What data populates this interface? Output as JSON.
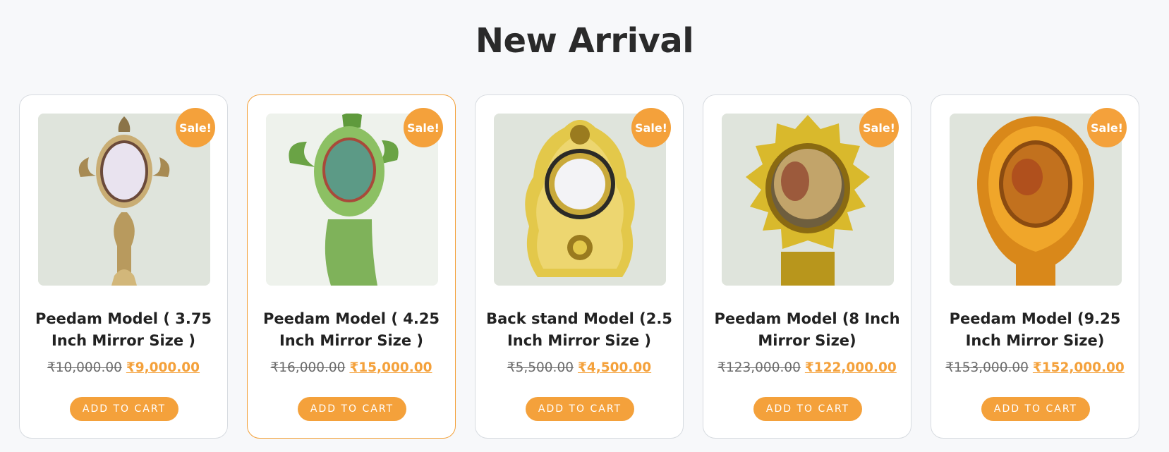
{
  "section": {
    "title": "New Arrival"
  },
  "colors": {
    "accent": "#f4a13b",
    "text": "#222222",
    "old_price": "#6b6b6b",
    "highlight_border": "#f3a13a"
  },
  "products": [
    {
      "name": "Peedam Model ( 3.75 Inch Mirror Size )",
      "badge": "Sale!",
      "old_price": "₹10,000.00",
      "new_price": "₹9,000.00",
      "button": "ADD TO CART",
      "image_icon": "mirror-icon",
      "metal": "silver-brass",
      "image_alt": "Peedam Model ( 3.75 Inch Mirror Size )"
    },
    {
      "name": "Peedam Model ( 4.25 Inch Mirror Size )",
      "badge": "Sale!",
      "old_price": "₹16,000.00",
      "new_price": "₹15,000.00",
      "button": "ADD TO CART",
      "image_icon": "mirror-icon",
      "metal": "green-brass",
      "image_alt": "Peedam Model ( 4.25 Inch Mirror Size )"
    },
    {
      "name": "Back stand Model (2.5 Inch Mirror Size )",
      "badge": "Sale!",
      "old_price": "₹5,500.00",
      "new_price": "₹4,500.00",
      "button": "ADD TO CART",
      "image_icon": "mirror-icon",
      "metal": "yellow-brass",
      "image_alt": "Back stand Model (2.5 Inch Mirror Size )"
    },
    {
      "name": "Peedam Model (8 Inch Mirror Size)",
      "badge": "Sale!",
      "old_price": "₹123,000.00",
      "new_price": "₹122,000.00",
      "button": "ADD TO CART",
      "image_icon": "mirror-icon",
      "metal": "gold-brass",
      "image_alt": "Peedam Model (8 Inch Mirror Size)"
    },
    {
      "name": "Peedam Model (9.25 Inch Mirror Size)",
      "badge": "Sale!",
      "old_price": "₹153,000.00",
      "new_price": "₹152,000.00",
      "button": "ADD TO CART",
      "image_icon": "mirror-icon",
      "metal": "deep-gold-brass",
      "image_alt": "Peedam Model (9.25 Inch Mirror Size)"
    }
  ]
}
